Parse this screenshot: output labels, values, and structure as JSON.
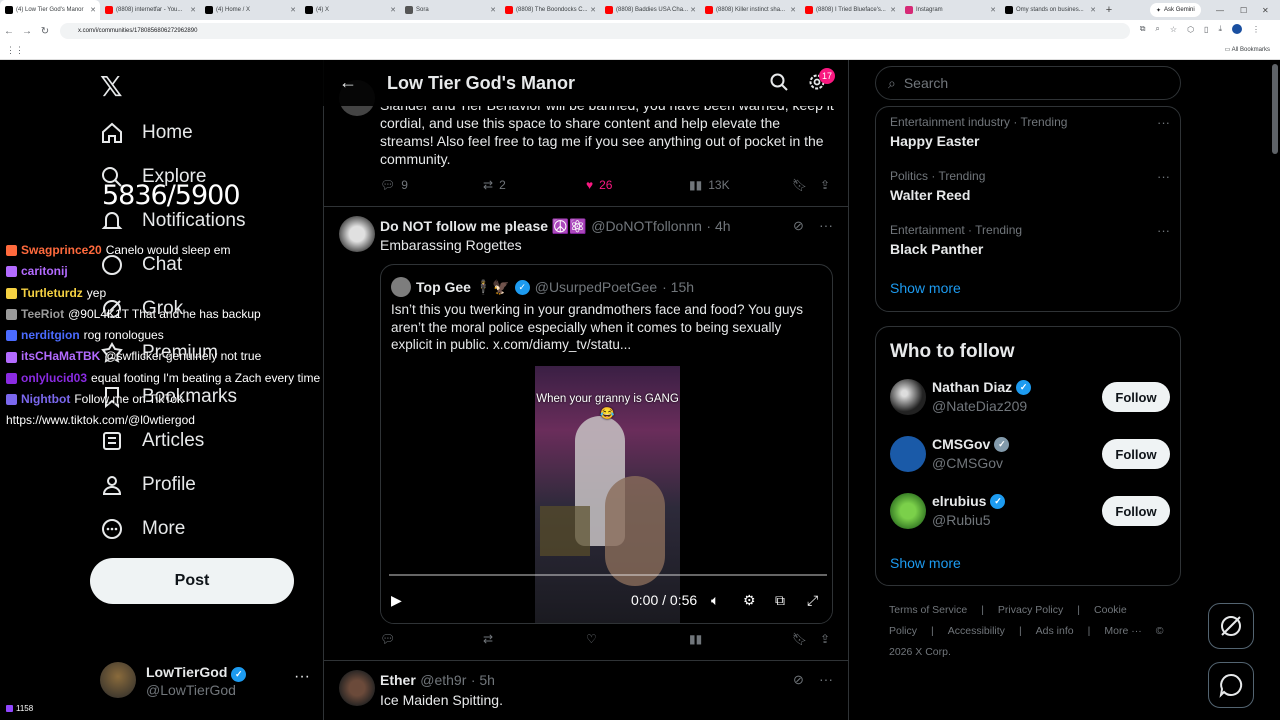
{
  "browser": {
    "tabs": [
      {
        "label": "(4) Low Tier God's Manor",
        "color": "#000000",
        "active": true
      },
      {
        "label": "(8808) internetfar - You...",
        "color": "#ff0000"
      },
      {
        "label": "(4) Home / X",
        "color": "#000000"
      },
      {
        "label": "(4) X",
        "color": "#000000"
      },
      {
        "label": "Sora",
        "color": "#555555"
      },
      {
        "label": "(8808) The Boondocks C...",
        "color": "#ff0000"
      },
      {
        "label": "(8808) Baddies USA Cha...",
        "color": "#ff0000"
      },
      {
        "label": "(8808) Killer instinct sha...",
        "color": "#ff0000"
      },
      {
        "label": "(8808) I Tried Blueface's...",
        "color": "#ff0000"
      },
      {
        "label": "Instagram",
        "color": "#d62976"
      },
      {
        "label": "Omy stands on busines...",
        "color": "#000000"
      }
    ],
    "new_tab": "+",
    "gemini": "Ask Gemini",
    "url": "x.com/i/communities/1780856806272962890",
    "all_bookmarks": "All Bookmarks"
  },
  "nav": {
    "items": [
      {
        "label": "Home",
        "icon": "home-icon"
      },
      {
        "label": "Explore",
        "icon": "search-icon"
      },
      {
        "label": "Notifications",
        "icon": "bell-icon"
      },
      {
        "label": "Chat",
        "icon": "chat-icon"
      },
      {
        "label": "Grok",
        "icon": "grok-icon"
      },
      {
        "label": "Premium",
        "icon": "x-premium-icon"
      },
      {
        "label": "Bookmarks",
        "icon": "bookmark-icon"
      },
      {
        "label": "Articles",
        "icon": "articles-icon"
      },
      {
        "label": "Profile",
        "icon": "profile-icon"
      },
      {
        "label": "More",
        "icon": "more-circle-icon"
      }
    ],
    "post_label": "Post",
    "account": {
      "name": "LowTierGod",
      "handle": "@LowTierGod",
      "more": "···"
    }
  },
  "overlay": {
    "counter": "5836/5900",
    "chat": [
      {
        "user": "Swagprince20",
        "color": "#ff6a3d",
        "msg": "Canelo would sleep em"
      },
      {
        "user": "caritonij",
        "color": "#b36bff",
        "msg": ""
      },
      {
        "user": "Turtleturdz",
        "color": "#f5d142",
        "msg": "yep"
      },
      {
        "user": "TeeRiot",
        "color": "#9a9a9a",
        "msg": "@90L4K1T That and he has backup"
      },
      {
        "user": "nerditgion",
        "color": "#4b6bff",
        "msg": "rog ronologues"
      },
      {
        "user": "itsCHaMaTBK",
        "color": "#b36bff",
        "msg": "@swflicker genuinely not true"
      },
      {
        "user": "onlylucid03",
        "color": "#8a2be2",
        "msg": "equal footing I'm beating a Zach every time"
      },
      {
        "user": "Nightbot",
        "color": "#7b68ee",
        "msg": "Follow me on TikTok -"
      },
      {
        "user": "",
        "color": "#ffffff",
        "msg": "https://www.tiktok.com/@l0wtiergod"
      }
    ],
    "viewers": "1158"
  },
  "main": {
    "title": "Low Tier God's Manor",
    "settings_badge": "17",
    "pinned_text": "Slander and Tier Behavior will be banned, you have been warned, keep it cordial, and use this space to share content and help elevate the streams! Also feel free to tag me if you see anything out of pocket in the community.",
    "pinned_actions": {
      "replies": "9",
      "reposts": "2",
      "likes": "26",
      "views": "13K"
    },
    "post2": {
      "name": "Do NOT follow me please ☮️⚛️",
      "handle": "@DoNOTfollonnn",
      "time": "· 4h",
      "text": "Embarassing Rogettes",
      "quote": {
        "name": "Top Gee 🕴️🦅",
        "handle": "@UsurpedPoetGee",
        "time": "· 15h",
        "text": "Isn’t this you twerking in your grandmothers face and food? You guys aren’t the moral police especially when it comes to being sexually explicit in public.  x.com/diamy_tv/statu...",
        "video_caption": "When your granny is GANG😂",
        "video_time": "0:00 / 0:56",
        "video_progress": 0
      }
    },
    "post3": {
      "name": "Ether",
      "handle": "@eth9r",
      "time": "· 5h",
      "text": "Ice Maiden Spitting."
    }
  },
  "right": {
    "search_placeholder": "Search",
    "trends": [
      {
        "category": "Entertainment industry · Trending",
        "title": "Happy Easter"
      },
      {
        "category": "Politics · Trending",
        "title": "Walter Reed"
      },
      {
        "category": "Entertainment · Trending",
        "title": "Black Panther"
      }
    ],
    "show_more": "Show more",
    "wtf_title": "Who to follow",
    "wtf": [
      {
        "name": "Nathan Diaz",
        "handle": "@NateDiaz209",
        "verified": "blue"
      },
      {
        "name": "CMSGov",
        "handle": "@CMSGov",
        "verified": "grey"
      },
      {
        "name": "elrubius",
        "handle": "@Rubiu5",
        "verified": "blue"
      }
    ],
    "follow_label": "Follow",
    "footer": [
      "Terms of Service",
      "|",
      "Privacy Policy",
      "|",
      "Cookie Policy",
      "|",
      "Accessibility",
      "|",
      "Ads info",
      "|",
      "More ···",
      "© 2026 X Corp."
    ]
  }
}
